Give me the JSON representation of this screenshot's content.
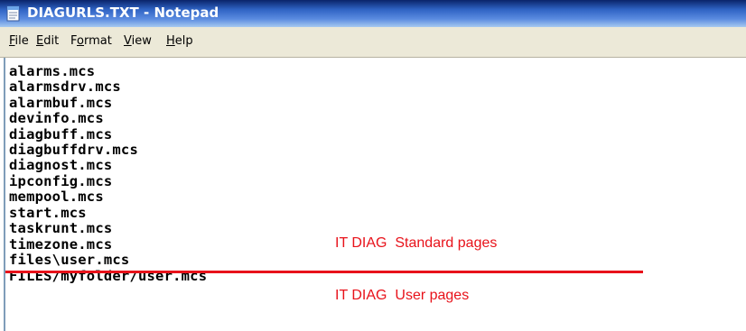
{
  "window": {
    "title": "DIAGURLS.TXT - Notepad"
  },
  "menu": [
    {
      "accel": "F",
      "rest": "ile"
    },
    {
      "accel": "E",
      "rest": "dit"
    },
    {
      "pre": "F",
      "accel": "o",
      "rest": "rmat"
    },
    {
      "accel": "V",
      "rest": "iew"
    },
    {
      "accel": "H",
      "rest": "elp"
    }
  ],
  "editor": {
    "lines": [
      "alarms.mcs",
      "alarmsdrv.mcs",
      "alarmbuf.mcs",
      "devinfo.mcs",
      "diagbuff.mcs",
      "diagbuffdrv.mcs",
      "diagnost.mcs",
      "ipconfig.mcs",
      "mempool.mcs",
      "start.mcs",
      "taskrunt.mcs",
      "timezone.mcs",
      "files\\user.mcs",
      "FILES/myfolder/user.mcs"
    ]
  },
  "annotations": {
    "standard_pages": "IT DIAG  Standard pages",
    "user_pages": "IT DIAG  User pages",
    "color": "#e8121a"
  }
}
